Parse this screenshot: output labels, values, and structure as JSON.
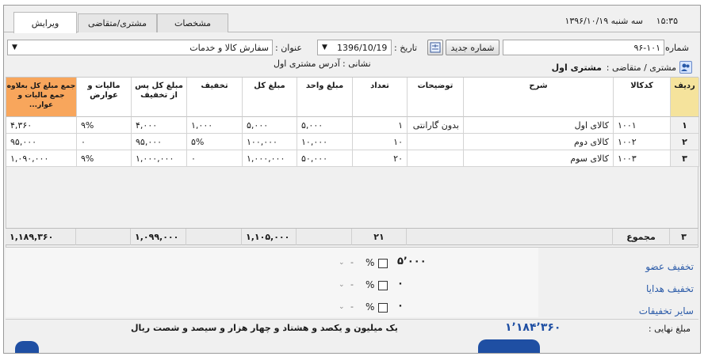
{
  "tabs": [
    {
      "label": "ویرایش",
      "active": true
    },
    {
      "label": "مشتری/متقاضی",
      "active": false
    },
    {
      "label": "مشخصات",
      "active": false
    }
  ],
  "status": {
    "time": "۱۵:۳۵",
    "date": "سه شنبه ۱۳۹۶/۱۰/۱۹"
  },
  "form": {
    "number_label": "شماره :",
    "number_value": "۹۶-۱۰۱",
    "new_number_button": "شماره جدید",
    "date_label": "تاریخ :",
    "date_value": "1396/10/19",
    "title_label": "عنوان :",
    "title_value": "سفارش کالا و خدمات",
    "customer_label": "مشتری / متقاضی :",
    "customer_value": "مشتری اول",
    "address_label": "نشانی :",
    "address_value": "آدرس مشتری اول"
  },
  "grid": {
    "headers": {
      "row": "ردیف",
      "code": "کدکالا",
      "desc": "شرح",
      "notes": "توضیحات",
      "qty": "تعداد",
      "unit": "مبلغ واحد",
      "total": "مبلغ کل",
      "discount": "تخفیف",
      "after": "مبلغ کل پس از تخفیف",
      "tax": "مالیات و عوارض",
      "grand": "جمع مبلغ کل بعلاوه جمع مالیات و عوار..."
    },
    "rows": [
      {
        "row": "۱",
        "code": "۱۰۰۱",
        "desc": "کالای اول",
        "notes": "بدون گارانتی",
        "qty": "۱",
        "unit": "۵,۰۰۰",
        "total": "۵,۰۰۰",
        "discount": "۱,۰۰۰",
        "after": "۴,۰۰۰",
        "tax": "۹%",
        "grand": "۴,۳۶۰"
      },
      {
        "row": "۲",
        "code": "۱۰۰۲",
        "desc": "کالای دوم",
        "notes": "",
        "qty": "۱۰",
        "unit": "۱۰,۰۰۰",
        "total": "۱۰۰,۰۰۰",
        "discount": "۵%",
        "after": "۹۵,۰۰۰",
        "tax": "۰",
        "grand": "۹۵,۰۰۰"
      },
      {
        "row": "۳",
        "code": "۱۰۰۳",
        "desc": "کالای سوم",
        "notes": "",
        "qty": "۲۰",
        "unit": "۵۰,۰۰۰",
        "total": "۱,۰۰۰,۰۰۰",
        "discount": "۰",
        "after": "۱,۰۰۰,۰۰۰",
        "tax": "۹%",
        "grand": "۱,۰۹۰,۰۰۰"
      }
    ],
    "totals": {
      "row": "۳",
      "label": "مجموع",
      "qty": "۲۱",
      "total": "۱,۱۰۵,۰۰۰",
      "after": "۱,۰۹۹,۰۰۰",
      "grand": "۱,۱۸۹,۳۶۰"
    }
  },
  "discounts": [
    {
      "label": "تخفیف عضو",
      "value": "۵٬۰۰۰",
      "percent": "%"
    },
    {
      "label": "تخفیف هدایا",
      "value": "۰",
      "percent": "%"
    },
    {
      "label": "سایر تخفیفات",
      "value": "۰",
      "percent": "%"
    }
  ],
  "final": {
    "label": "مبلغ نهایی :",
    "amount": "۱٬۱۸۴٬۳۶۰",
    "words": "یک میلیون و یکصد و هشتاد و چهار هزار و سیصد و شصت ریال"
  }
}
